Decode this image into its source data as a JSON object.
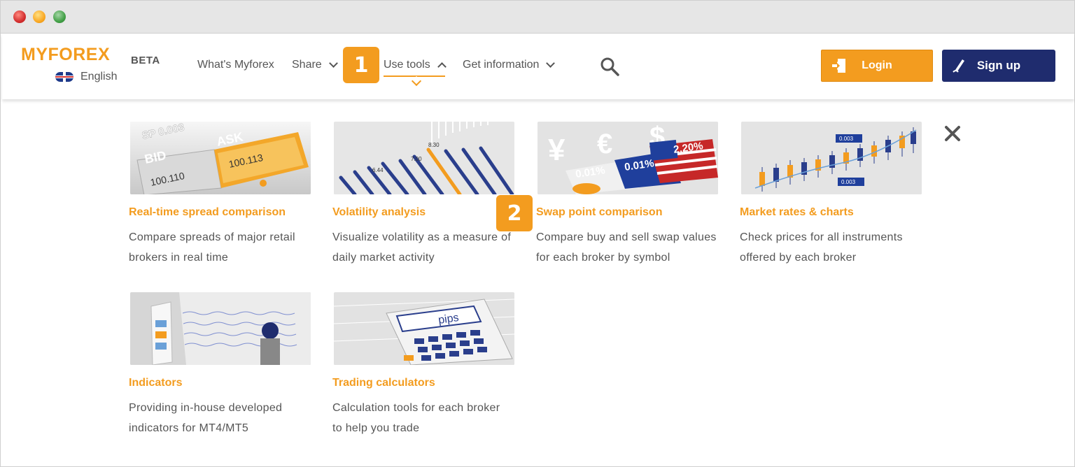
{
  "window": {
    "title": ""
  },
  "header": {
    "logo": {
      "my": "MY",
      "forex": "FOREX",
      "beta": "BETA"
    },
    "language": "English",
    "nav": [
      {
        "label": "What's Myforex"
      },
      {
        "label": "Share"
      },
      {
        "label": "Use tools"
      },
      {
        "label": "Get information"
      }
    ],
    "login_label": "Login",
    "signup_label": "Sign up"
  },
  "badges": {
    "one": "1",
    "two": "2"
  },
  "tools": [
    {
      "title": "Real-time spread comparison",
      "desc_line1": "Compare spreads of major retail",
      "desc_line2": "brokers in real time",
      "img": {
        "bid": "BID",
        "ask": "ASK",
        "bid_val": "100.110",
        "ask_val": "100.113",
        "sp": "SP 0.003"
      }
    },
    {
      "title": "Volatility analysis",
      "desc_line1": "Visualize volatility as a measure of",
      "desc_line2": "daily market activity",
      "img": {
        "a": "6.44",
        "b": "7.00",
        "c": "8.30"
      }
    },
    {
      "title": "Swap point comparison",
      "desc_line1": "Compare buy and sell swap values",
      "desc_line2": "for each broker by symbol",
      "img": {
        "a": "0.01%",
        "b": "0.01%",
        "c": "2.20%"
      }
    },
    {
      "title": "Market rates & charts",
      "desc_line1": "Check prices for all instruments",
      "desc_line2": "offered by each broker",
      "img": {
        "a": "0.003",
        "b": "0.003"
      }
    },
    {
      "title": "Indicators",
      "desc_line1": "Providing in-house developed",
      "desc_line2": "indicators for MT4/MT5"
    },
    {
      "title": "Trading calculators",
      "desc_line1": "Calculation tools for each broker",
      "desc_line2": "to help you trade",
      "img": {
        "display": "pips"
      }
    }
  ],
  "colors": {
    "accent": "#f39c1f",
    "navy": "#1f2c6e"
  }
}
